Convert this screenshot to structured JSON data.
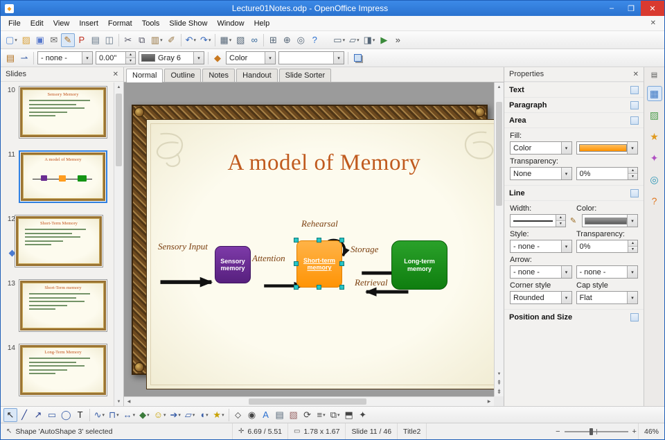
{
  "window": {
    "title": "Lecture01Notes.odp - OpenOffice Impress"
  },
  "icons": {
    "minimize": "–",
    "maximize": "❐",
    "close": "✕",
    "document_close": "✕",
    "panel_close": "✕",
    "dropdown": "▾",
    "spin_up": "▴",
    "spin_down": "▾",
    "scroll_up": "▲",
    "scroll_down": "▼",
    "scroll_left": "◀",
    "scroll_right": "▶",
    "prev_slide": "⇞",
    "next_slide": "⇟",
    "pencil": "✎",
    "selection_arrow": "↖",
    "move_cross": "✛",
    "size_rect": "▭",
    "zoom_minus": "−",
    "zoom_plus": "+",
    "app": "◆"
  },
  "menu": {
    "items": [
      "File",
      "Edit",
      "View",
      "Insert",
      "Format",
      "Tools",
      "Slide Show",
      "Window",
      "Help"
    ]
  },
  "toolbar_main": {
    "items": [
      {
        "name": "new-document",
        "glyph": "▢",
        "color": "#5b8dd6",
        "drop": true
      },
      {
        "name": "open-folder",
        "glyph": "▨",
        "color": "#d9a441"
      },
      {
        "name": "save",
        "glyph": "▣",
        "color": "#5577cc"
      },
      {
        "name": "email",
        "glyph": "✉",
        "color": "#666666"
      },
      {
        "name": "edit-file",
        "glyph": "✎",
        "color": "#b07020",
        "pressed": true
      },
      {
        "name": "export-pdf",
        "glyph": "P",
        "color": "#c03020"
      },
      {
        "name": "print",
        "glyph": "▤",
        "color": "#667788"
      },
      {
        "name": "page-preview",
        "glyph": "◫",
        "color": "#667788"
      },
      {
        "sep": true
      },
      {
        "name": "cut",
        "glyph": "✂",
        "color": "#555566"
      },
      {
        "name": "copy",
        "glyph": "⧉",
        "color": "#555566"
      },
      {
        "name": "paste",
        "glyph": "▥",
        "color": "#997744",
        "drop": true
      },
      {
        "name": "clone-formatting",
        "glyph": "✐",
        "color": "#997744"
      },
      {
        "sep": true
      },
      {
        "name": "undo",
        "glyph": "↶",
        "color": "#3366bb",
        "drop": true
      },
      {
        "name": "redo",
        "glyph": "↷",
        "color": "#3366bb",
        "drop": true
      },
      {
        "sep": true
      },
      {
        "name": "table",
        "glyph": "▦",
        "color": "#556677",
        "drop": true
      },
      {
        "name": "chart",
        "glyph": "▧",
        "color": "#556677"
      },
      {
        "name": "hyperlink",
        "glyph": "∞",
        "color": "#336699"
      },
      {
        "sep": true
      },
      {
        "name": "show-grid",
        "glyph": "⊞",
        "color": "#556677"
      },
      {
        "name": "navigator",
        "glyph": "⊕",
        "color": "#556677"
      },
      {
        "name": "zoom",
        "glyph": "◎",
        "color": "#556677"
      },
      {
        "name": "help",
        "glyph": "?",
        "color": "#2a6fd0"
      },
      {
        "gap": true
      },
      {
        "name": "display-mode",
        "glyph": "▭",
        "color": "#556677",
        "drop": true
      },
      {
        "name": "new-slide",
        "glyph": "▱",
        "color": "#556677",
        "drop": true
      },
      {
        "name": "slide-layout",
        "glyph": "◨",
        "color": "#556677",
        "drop": true
      },
      {
        "name": "slideshow",
        "glyph": "▶",
        "color": "#3a8a3a"
      },
      {
        "name": "toolbar-overflow",
        "glyph": "»",
        "color": "#444444"
      }
    ]
  },
  "toolbar_line": {
    "style_value": "- none -",
    "width_value": "0.00\"",
    "color_value": "Gray 6",
    "fill_type_value": "Color",
    "fill_value": ""
  },
  "slides_panel": {
    "title": "Slides",
    "slides": [
      {
        "num": "10",
        "title": "Sensory Memory",
        "kind": "bullets",
        "selected": false,
        "indicator": false
      },
      {
        "num": "11",
        "title": "A model of Memory",
        "kind": "diagram",
        "selected": true,
        "indicator": false
      },
      {
        "num": "12",
        "title": "Short-Term Memory",
        "kind": "bullets",
        "selected": false,
        "indicator": true
      },
      {
        "num": "13",
        "title": "Short-Term memory",
        "kind": "bullets",
        "selected": false,
        "indicator": false
      },
      {
        "num": "14",
        "title": "Long-Term Memory",
        "kind": "bullets",
        "selected": false,
        "indicator": false
      }
    ]
  },
  "view_tabs": {
    "items": [
      "Normal",
      "Outline",
      "Notes",
      "Handout",
      "Slide Sorter"
    ],
    "active_index": 0
  },
  "slide": {
    "title": "A model of Memory",
    "title_color": "#c05a1e",
    "labels": {
      "sensory_input": "Sensory Input",
      "attention": "Attention",
      "rehearsal": "Rehearsal",
      "storage": "Storage",
      "retrieval": "Retrieval"
    },
    "boxes": {
      "sensory": {
        "label": "Sensory memory",
        "color": "#6a2d91"
      },
      "short_term": {
        "label": "Short-term memory",
        "color": "#ff9d1e",
        "selected": true
      },
      "long_term": {
        "label": "Long-term memory",
        "color": "#149414"
      }
    }
  },
  "properties_panel": {
    "title": "Properties",
    "sections": {
      "text": "Text",
      "paragraph": "Paragraph",
      "area": "Area",
      "line": "Line",
      "position": "Position and Size"
    },
    "area": {
      "fill_label": "Fill:",
      "fill_type": "Color",
      "transparency_label": "Transparency:",
      "transparency_type": "None",
      "transparency_value": "0%"
    },
    "line": {
      "width_label": "Width:",
      "color_label": "Color:",
      "style_label": "Style:",
      "style_value": "- none -",
      "transparency_label": "Transparency:",
      "transparency_value": "0%",
      "arrow_label": "Arrow:",
      "arrow_start": "- none -",
      "arrow_end": "- none -",
      "corner_label": "Corner style",
      "corner_value": "Rounded",
      "cap_label": "Cap style",
      "cap_value": "Flat"
    }
  },
  "sidebar_tabs": {
    "items": [
      {
        "name": "sidebar-menu",
        "glyph": "▤",
        "color": "#555555",
        "small": true
      },
      {
        "name": "properties-deck",
        "glyph": "▦",
        "color": "#3b76c4",
        "active": true
      },
      {
        "name": "gallery-deck",
        "glyph": "▨",
        "color": "#4f9e4f"
      },
      {
        "name": "styles-deck",
        "glyph": "★",
        "color": "#e09a20"
      },
      {
        "name": "animation-deck",
        "glyph": "✦",
        "color": "#b04fc2"
      },
      {
        "name": "navigator-deck",
        "glyph": "◎",
        "color": "#2a95b5"
      },
      {
        "name": "master-pages-deck",
        "glyph": "?",
        "color": "#e07820"
      }
    ]
  },
  "toolbar_drawing": {
    "items": [
      {
        "name": "select",
        "glyph": "↖",
        "color": "#222222",
        "pressed": true
      },
      {
        "name": "line",
        "glyph": "╱",
        "color": "#223a8c"
      },
      {
        "name": "line-arrow-end",
        "glyph": "↗",
        "color": "#223a8c"
      },
      {
        "name": "rectangle",
        "glyph": "▭",
        "color": "#3a5fa8"
      },
      {
        "name": "ellipse",
        "glyph": "◯",
        "color": "#3a5fa8"
      },
      {
        "name": "text",
        "glyph": "T",
        "color": "#222222"
      },
      {
        "sep": true
      },
      {
        "name": "curve",
        "glyph": "∿",
        "color": "#3a5fa8",
        "drop": true
      },
      {
        "name": "connector",
        "glyph": "⊓",
        "color": "#3a5fa8",
        "drop": true
      },
      {
        "name": "lines-arrows",
        "glyph": "↔",
        "color": "#3a5fa8",
        "drop": true
      },
      {
        "name": "basic-shapes",
        "glyph": "◆",
        "color": "#3a7a3a",
        "drop": true
      },
      {
        "name": "symbol-shapes",
        "glyph": "☺",
        "color": "#c8a200",
        "drop": true
      },
      {
        "name": "block-arrows",
        "glyph": "➔",
        "color": "#3a5fa8",
        "drop": true
      },
      {
        "name": "flowchart",
        "glyph": "▱",
        "color": "#3a5fa8",
        "drop": true
      },
      {
        "name": "callouts",
        "glyph": "◖",
        "color": "#3a5fa8",
        "drop": true
      },
      {
        "name": "stars",
        "glyph": "★",
        "color": "#c8a200",
        "drop": true
      },
      {
        "sep": true
      },
      {
        "name": "edit-points",
        "glyph": "⬦",
        "color": "#444444"
      },
      {
        "name": "glue-points",
        "glyph": "◉",
        "color": "#444444"
      },
      {
        "name": "fontwork",
        "glyph": "A",
        "color": "#2a6fd0"
      },
      {
        "name": "insert-picture",
        "glyph": "▤",
        "color": "#556677"
      },
      {
        "name": "gallery",
        "glyph": "▧",
        "color": "#996666"
      },
      {
        "name": "rotate",
        "glyph": "⟳",
        "color": "#444444"
      },
      {
        "name": "align",
        "glyph": "≡",
        "color": "#444444",
        "drop": true
      },
      {
        "name": "arrange",
        "glyph": "⧉",
        "color": "#444444",
        "drop": true
      },
      {
        "name": "extrusion",
        "glyph": "⬒",
        "color": "#444444"
      },
      {
        "name": "interaction",
        "glyph": "✦",
        "color": "#444444"
      }
    ]
  },
  "status_bar": {
    "selection": "Shape 'AutoShape 3' selected",
    "position": "6.69 / 5.51",
    "size": "1.78 x 1.67",
    "slide": "Slide 11 / 46",
    "layout": "Title2",
    "zoom": "46%"
  }
}
